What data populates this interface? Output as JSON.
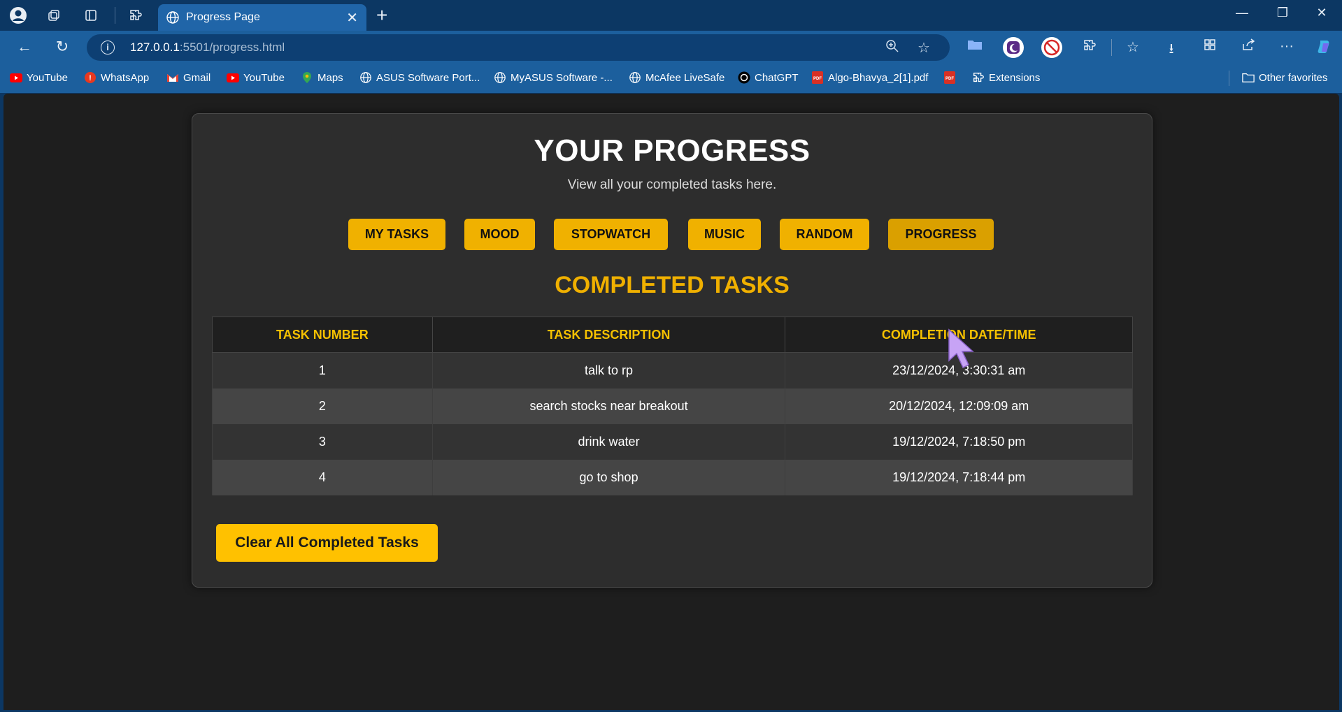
{
  "browser": {
    "tab_title": "Progress Page",
    "url_host": "127.0.0.1",
    "url_rest": ":5501/progress.html",
    "bookmarks": [
      {
        "label": "YouTube",
        "icon": "youtube-icon"
      },
      {
        "label": "WhatsApp",
        "icon": "whatsapp-icon"
      },
      {
        "label": "Gmail",
        "icon": "gmail-icon"
      },
      {
        "label": "YouTube",
        "icon": "youtube-icon"
      },
      {
        "label": "Maps",
        "icon": "maps-icon"
      },
      {
        "label": "ASUS Software Port...",
        "icon": "globe-icon"
      },
      {
        "label": "MyASUS Software -...",
        "icon": "globe-icon"
      },
      {
        "label": "McAfee LiveSafe",
        "icon": "globe-icon"
      },
      {
        "label": "ChatGPT",
        "icon": "chatgpt-icon"
      },
      {
        "label": "Algo-Bhavya_2[1].pdf",
        "icon": "pdf-icon"
      },
      {
        "label": "Extensions",
        "icon": "extensions-icon"
      }
    ],
    "other_favorites": "Other favorites"
  },
  "page": {
    "heading": "YOUR PROGRESS",
    "subheading": "View all your completed tasks here.",
    "nav": [
      "MY TASKS",
      "MOOD",
      "STOPWATCH",
      "MUSIC",
      "RANDOM",
      "PROGRESS"
    ],
    "active_nav": "PROGRESS",
    "section_title": "COMPLETED TASKS",
    "table": {
      "headers": [
        "TASK NUMBER",
        "TASK DESCRIPTION",
        "COMPLETION DATE/TIME"
      ],
      "rows": [
        [
          "1",
          "talk to rp",
          "23/12/2024, 3:30:31 am"
        ],
        [
          "2",
          "search stocks near breakout",
          "20/12/2024, 12:09:09 am"
        ],
        [
          "3",
          "drink water",
          "19/12/2024, 7:18:50 pm"
        ],
        [
          "4",
          "go to shop",
          "19/12/2024, 7:18:44 pm"
        ]
      ]
    },
    "clear_button": "Clear All Completed Tasks"
  },
  "colors": {
    "accent": "#f0b100",
    "page_bg": "#1e1e1e",
    "card_bg": "#2d2d2d",
    "browser_frame": "#0c3763"
  }
}
